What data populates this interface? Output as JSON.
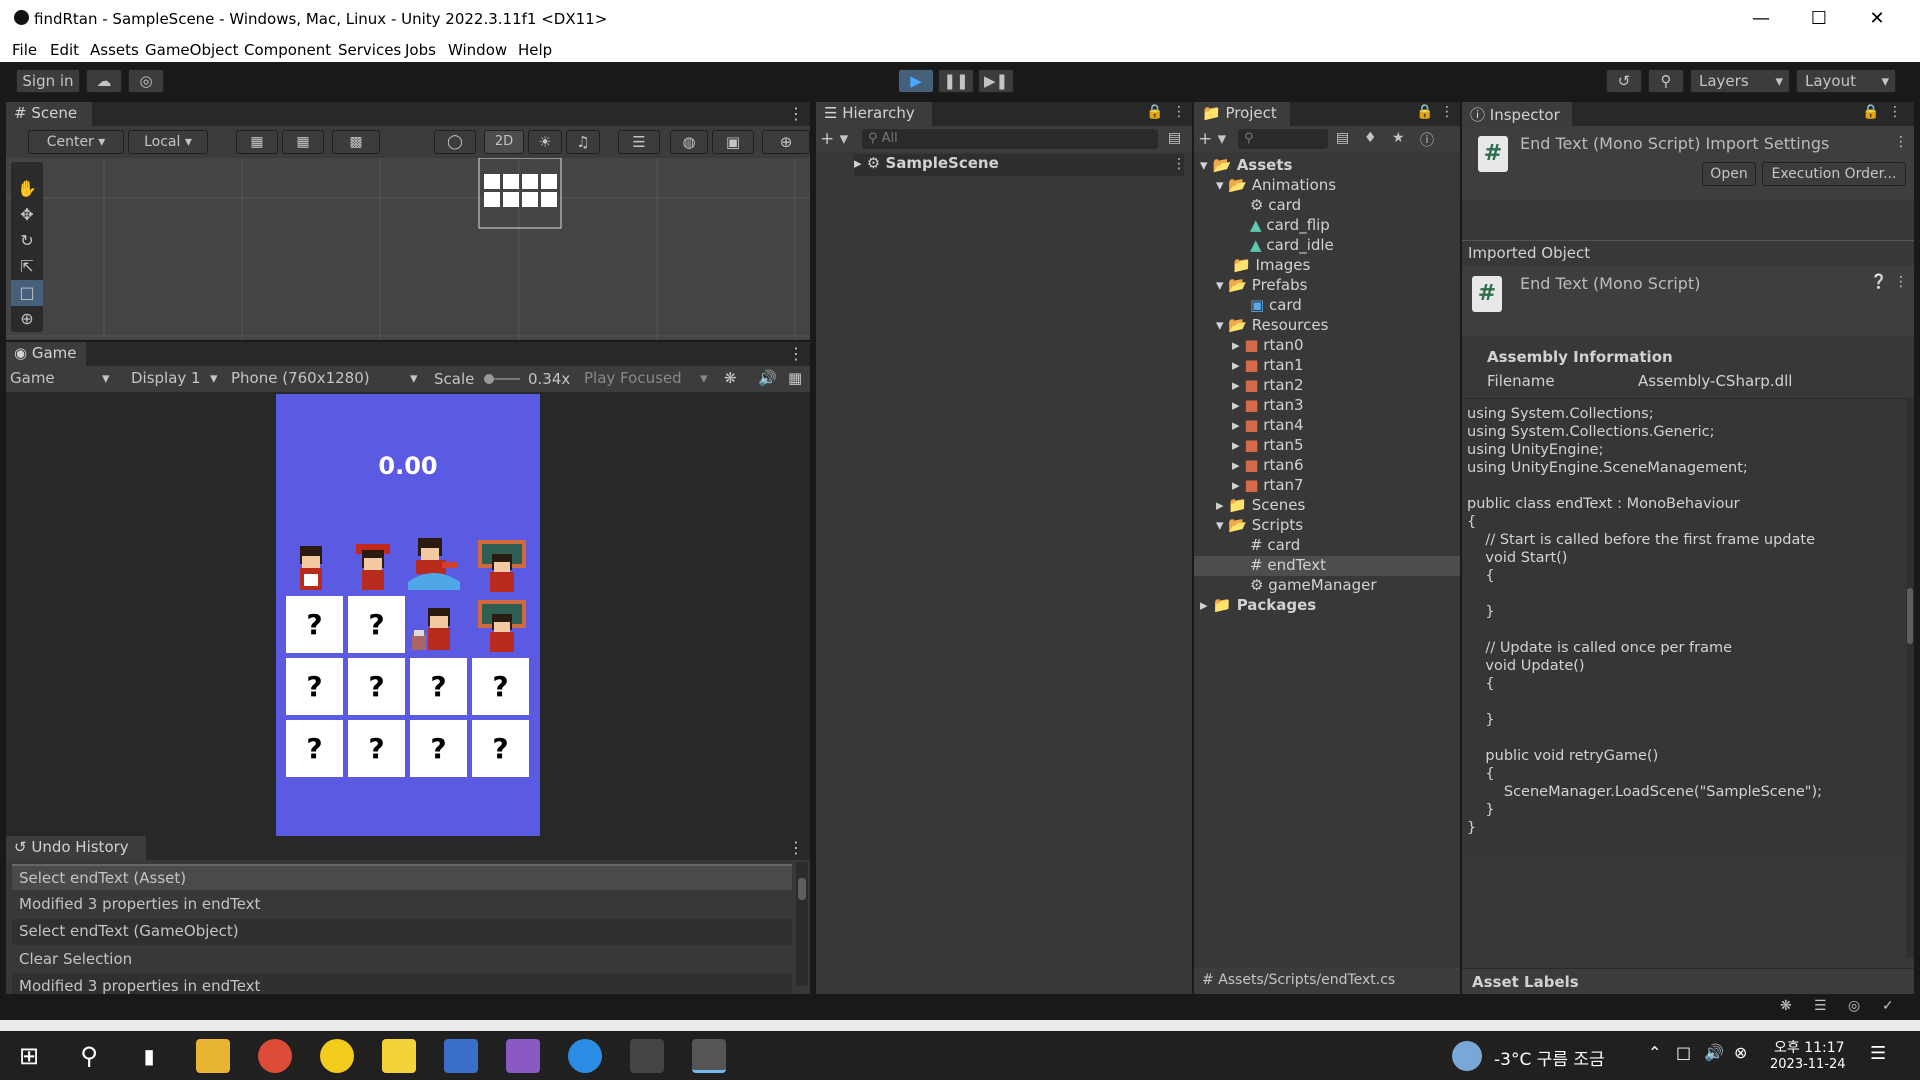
{
  "window": {
    "title": "findRtan - SampleScene - Windows, Mac, Linux - Unity 2022.3.11f1 <DX11>"
  },
  "menu": [
    "File",
    "Edit",
    "Assets",
    "GameObject",
    "Component",
    "Services",
    "Jobs",
    "Window",
    "Help"
  ],
  "toolbar": {
    "sign_in": "Sign in",
    "layers": "Layers",
    "layout": "Layout"
  },
  "scene": {
    "tab": "Scene",
    "pivot": "Center",
    "space": "Local",
    "mode2d": "2D"
  },
  "game": {
    "tab": "Game",
    "mode": "Game",
    "display": "Display 1",
    "resolution": "Phone (760x1280)",
    "scale_label": "Scale",
    "scale_value": "0.34x",
    "play_focused": "Play Focused",
    "timer": "0.00",
    "card_mark": "?"
  },
  "undo": {
    "tab": "Undo History",
    "items": [
      "Select endText (Asset)",
      "Modified 3 properties in endText",
      "Select endText (GameObject)",
      "Clear Selection",
      "Modified 3 properties in endText"
    ]
  },
  "hierarchy": {
    "tab": "Hierarchy",
    "search_placeholder": "All",
    "scene": "SampleScene"
  },
  "project": {
    "tab": "Project",
    "tree": {
      "assets": "Assets",
      "animations": "Animations",
      "anim_items": [
        "card",
        "card_flip",
        "card_idle"
      ],
      "images": "Images",
      "prefabs": "Prefabs",
      "prefab_items": [
        "card"
      ],
      "resources": "Resources",
      "resource_items": [
        "rtan0",
        "rtan1",
        "rtan2",
        "rtan3",
        "rtan4",
        "rtan5",
        "rtan6",
        "rtan7"
      ],
      "scenes": "Scenes",
      "scripts": "Scripts",
      "script_items": [
        "card",
        "endText",
        "gameManager"
      ],
      "packages": "Packages"
    },
    "path": "Assets/Scripts/endText.cs"
  },
  "inspector": {
    "tab": "Inspector",
    "title": "End Text (Mono Script) Import Settings",
    "open": "Open",
    "exec_order": "Execution Order...",
    "imported_object": "Imported Object",
    "object_name": "End Text (Mono Script)",
    "assembly_info": "Assembly Information",
    "filename_label": "Filename",
    "filename_value": "Assembly-CSharp.dll",
    "code": "using System.Collections;\nusing System.Collections.Generic;\nusing UnityEngine;\nusing UnityEngine.SceneManagement;\n\npublic class endText : MonoBehaviour\n{\n    // Start is called before the first frame update\n    void Start()\n    {\n\n    }\n\n    // Update is called once per frame\n    void Update()\n    {\n\n    }\n\n    public void retryGame()\n    {\n        SceneManager.LoadScene(\"SampleScene\");\n    }\n}",
    "asset_labels": "Asset Labels"
  },
  "taskbar": {
    "weather": "-3°C 구름 조금",
    "time": "오후 11:17",
    "date": "2023-11-24"
  }
}
